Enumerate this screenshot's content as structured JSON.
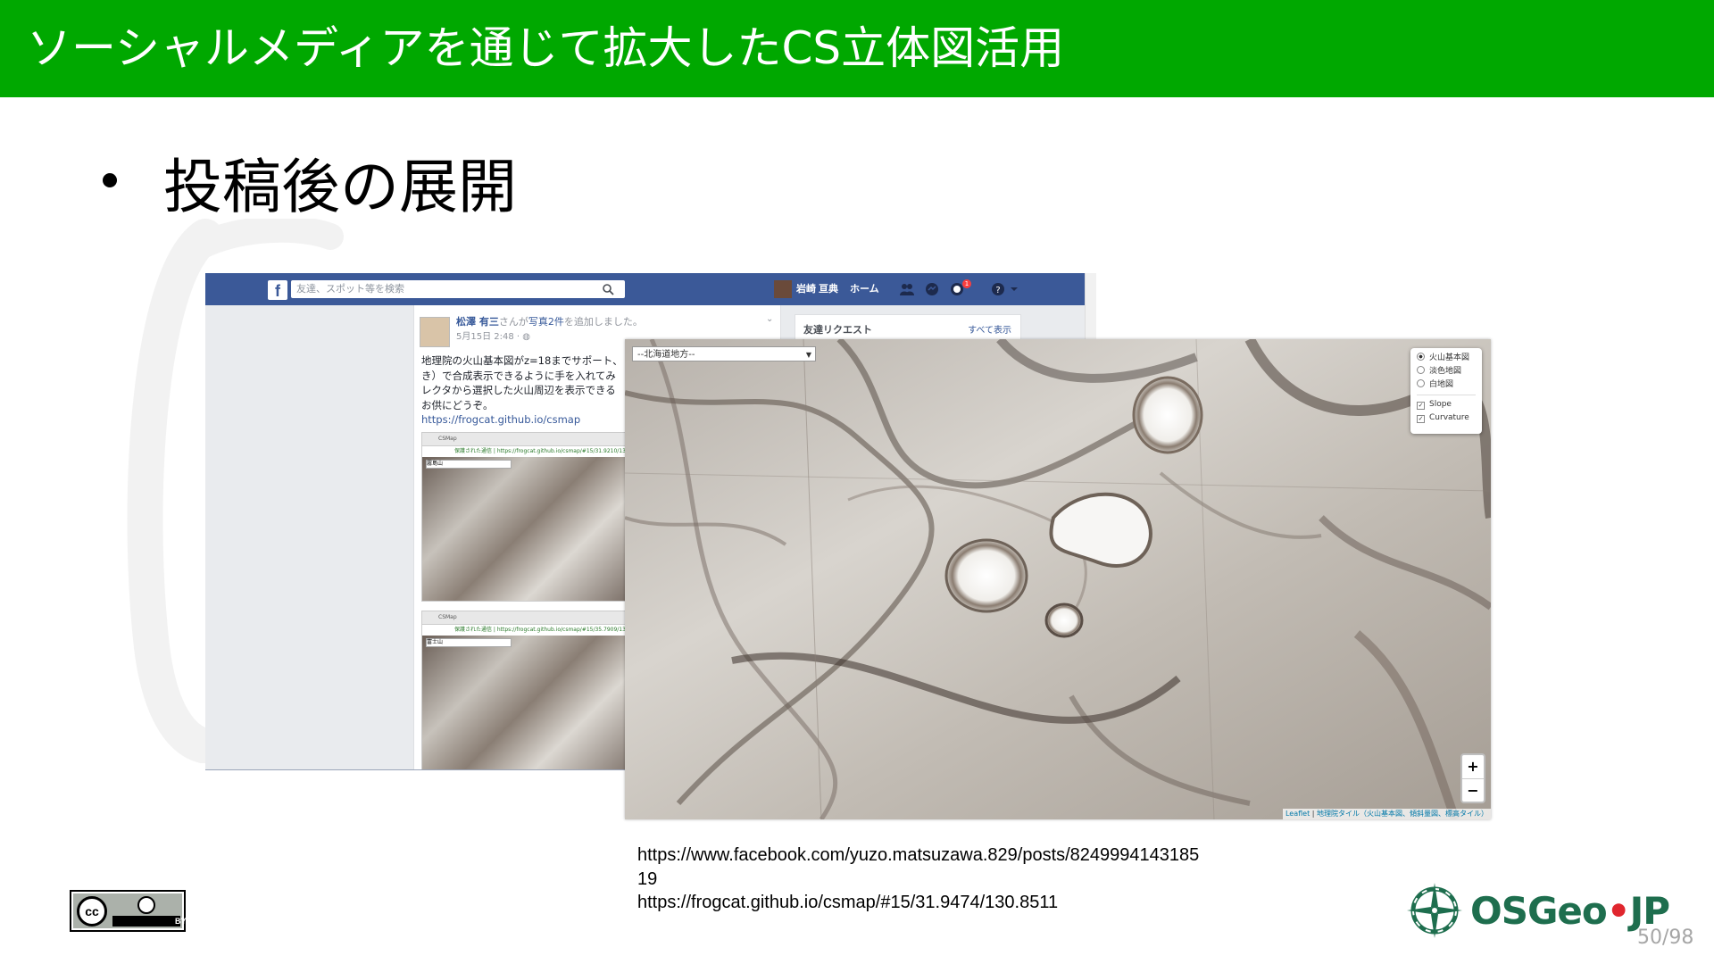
{
  "slide": {
    "title": "ソーシャルメディアを通じて拡大したCS立体図活用",
    "bullet": "投稿後の展開",
    "page_number": "50/98"
  },
  "facebook": {
    "search_placeholder": "友達、スポット等を検索",
    "user_name": "岩崎 亘典",
    "home_label": "ホーム",
    "notification_count": "1",
    "post_author": "松澤 有三",
    "post_action_pre": "さんが",
    "post_action_link": "写真2件",
    "post_action_post": "を追加しました。",
    "post_date": "5月15日 2:48 · ",
    "post_lines": [
      "地理院の火山基本図がz=18までサポート、",
      "き）で合成表示できるように手を入れてみ",
      "レクタから選択した火山周辺を表示できる",
      "お供にどうぞ。"
    ],
    "post_link": "https://frogcat.github.io/csmap",
    "friend_requests": "友達リクエスト",
    "see_all": "すべて表示",
    "thumb_tab": "CSMap",
    "thumb_url_1": "保護された通信 | https://frogcat.github.io/csmap/#15/31.9210/130.8",
    "thumb_select_1": "霧島山",
    "thumb_url_2": "保護された通信 | https://frogcat.github.io/csmap/#15/35.7909/138.7",
    "thumb_select_2": "富士山"
  },
  "map": {
    "region_select": "--北海道地方--",
    "base_layers": [
      "火山基本図",
      "淡色地図",
      "白地図"
    ],
    "selected_base_layer": "火山基本図",
    "overlays": [
      {
        "label": "Slope",
        "checked": true
      },
      {
        "label": "Curvature",
        "checked": true
      }
    ],
    "zoom_in": "+",
    "zoom_out": "−",
    "attribution_leaflet": "Leaflet",
    "attribution_rest": "地理院タイル（火山基本図、傾斜量図、標高タイル）"
  },
  "sources": {
    "url1_line1": "https://www.facebook.com/yuzo.matsuzawa.829/posts/8249994143185",
    "url1_line2": "19",
    "url2": "https://frogcat.github.io/csmap/#15/31.9474/130.8511"
  },
  "license": {
    "cc": "cc",
    "by": "BY"
  },
  "logo": {
    "text_left": "OSGeo",
    "separator": "•",
    "text_right": "JP"
  },
  "colors": {
    "header": "#00a800",
    "facebook_blue": "#3b5998",
    "osgeo_green": "#1e6e4e",
    "osgeo_red": "#e0262e"
  }
}
